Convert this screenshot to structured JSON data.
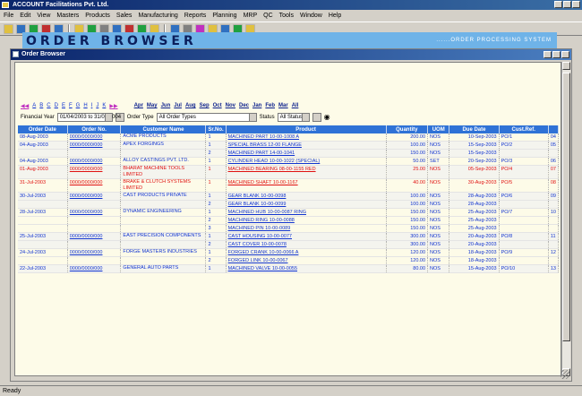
{
  "app": {
    "title": "ACCOUNT Facilitations Pvt. Ltd."
  },
  "menu": [
    "File",
    "Edit",
    "View",
    "Masters",
    "Products",
    "Sales",
    "Manufacturing",
    "Reports",
    "Planning",
    "MRP",
    "QC",
    "Tools",
    "Window",
    "Help"
  ],
  "window": {
    "title": "Order Browser"
  },
  "browser": {
    "title": "ORDER BROWSER",
    "tagline": "......ORDER PROCESSING SYSTEM"
  },
  "alphabet": [
    "A",
    "B",
    "C",
    "D",
    "E",
    "F",
    "G",
    "H",
    "I",
    "J",
    "K"
  ],
  "months": [
    "Apr",
    "May",
    "Jun",
    "Jul",
    "Aug",
    "Sep",
    "Oct",
    "Nov",
    "Dec",
    "Jan",
    "Feb",
    "Mar",
    "All"
  ],
  "filters": {
    "period_label": "Financial Year",
    "period_value": "01/04/2003 to 31/03/2004",
    "order_type_label": "Order Type",
    "order_type_value": "All Order Types",
    "status_label": "Status",
    "status_value": "All Status"
  },
  "table": {
    "columns": [
      "Order Date",
      "Order No.",
      "Customer Name",
      "Sr.No.",
      "Product",
      "Quantity",
      "UOM",
      "Due Date",
      "Cust.Ref.",
      ""
    ],
    "rows": [
      {
        "date": "08-Aug-2003",
        "order": "0000/0000/000",
        "customer": "ACME PRODUCTS",
        "items": [
          {
            "sr": "1",
            "product": "MACHINED PART 10-00-1008 A",
            "qty": "200.00",
            "uom": "NOS",
            "due": "10-Sep-2003",
            "ref": "PO/1",
            "x": "04"
          }
        ],
        "red": false
      },
      {
        "date": "04-Aug-2003",
        "order": "0000/0000/000",
        "customer": "APEX FORGINGS",
        "items": [
          {
            "sr": "1",
            "product": "SPECIAL BRASS 12-00 FLANGE",
            "qty": "100.00",
            "uom": "NOS",
            "due": "15-Sep-2003",
            "ref": "PO/2",
            "x": "05"
          },
          {
            "sr": "2",
            "product": "MACHINED PART 14-00-1041",
            "qty": "150.00",
            "uom": "NOS",
            "due": "15-Sep-2003",
            "ref": "",
            "x": ""
          }
        ],
        "red": false
      },
      {
        "date": "04-Aug-2003",
        "order": "0000/0000/000",
        "customer": "ALLOY CASTINGS PVT. LTD.",
        "items": [
          {
            "sr": "1",
            "product": "CYLINDER HEAD 10-00-1022 (SPECIAL)",
            "qty": "50.00",
            "uom": "SET",
            "due": "20-Sep-2003",
            "ref": "PO/3",
            "x": "06"
          }
        ],
        "red": false
      },
      {
        "date": "01-Aug-2003",
        "order": "0000/0000/000",
        "customer": "BHARAT MACHINE TOOLS LIMITED",
        "items": [
          {
            "sr": "1",
            "product": "MACHINED BEARING 08-00-1155 RED",
            "qty": "25.00",
            "uom": "NOS",
            "due": "05-Sep-2003",
            "ref": "PO/4",
            "x": "07"
          }
        ],
        "red": true
      },
      {
        "date": "31-Jul-2003",
        "order": "0000/0000/000",
        "customer": "BRAKE & CLUTCH SYSTEMS LIMITED",
        "items": [
          {
            "sr": "1",
            "product": "MACHINED SHAFT 10-00-1167",
            "qty": "40.00",
            "uom": "NOS",
            "due": "30-Aug-2003",
            "ref": "PO/5",
            "x": "08"
          }
        ],
        "red": true
      },
      {
        "date": "30-Jul-2003",
        "order": "0000/0000/000",
        "customer": "CAST PRODUCTS PRIVATE",
        "items": [
          {
            "sr": "1",
            "product": "GEAR BLANK 10-00-0098",
            "qty": "100.00",
            "uom": "NOS",
            "due": "28-Aug-2003",
            "ref": "PO/6",
            "x": "09"
          },
          {
            "sr": "2",
            "product": "GEAR BLANK 10-00-0099",
            "qty": "100.00",
            "uom": "NOS",
            "due": "28-Aug-2003",
            "ref": "",
            "x": ""
          }
        ],
        "red": false
      },
      {
        "date": "28-Jul-2003",
        "order": "0000/0000/000",
        "customer": "DYNAMIC ENGINEERING",
        "items": [
          {
            "sr": "1",
            "product": "MACHINED HUB 10-00-0087 RING",
            "qty": "150.00",
            "uom": "NOS",
            "due": "25-Aug-2003",
            "ref": "PO/7",
            "x": "10"
          },
          {
            "sr": "2",
            "product": "MACHINED RING 10-00-0088",
            "qty": "150.00",
            "uom": "NOS",
            "due": "25-Aug-2003",
            "ref": "",
            "x": ""
          },
          {
            "sr": "3",
            "product": "MACHINED PIN 10-00-0089",
            "qty": "150.00",
            "uom": "NOS",
            "due": "25-Aug-2003",
            "ref": "",
            "x": ""
          }
        ],
        "red": false
      },
      {
        "date": "25-Jul-2003",
        "order": "0000/0000/000",
        "customer": "EAST PRECISION COMPONENTS",
        "items": [
          {
            "sr": "1",
            "product": "CAST HOUSING 10-00-0077",
            "qty": "300.00",
            "uom": "NOS",
            "due": "20-Aug-2003",
            "ref": "PO/8",
            "x": "11"
          },
          {
            "sr": "2",
            "product": "CAST COVER 10-00-0078",
            "qty": "300.00",
            "uom": "NOS",
            "due": "20-Aug-2003",
            "ref": "",
            "x": ""
          }
        ],
        "red": false
      },
      {
        "date": "24-Jul-2003",
        "order": "0000/0000/000",
        "customer": "FORGE MASTERS INDUSTRIES",
        "items": [
          {
            "sr": "1",
            "product": "FORGED CRANK 10-00-0066 A",
            "qty": "120.00",
            "uom": "NOS",
            "due": "18-Aug-2003",
            "ref": "PO/9",
            "x": "12"
          },
          {
            "sr": "2",
            "product": "FORGED LINK 10-00-0067",
            "qty": "120.00",
            "uom": "NOS",
            "due": "18-Aug-2003",
            "ref": "",
            "x": ""
          }
        ],
        "red": false
      },
      {
        "date": "22-Jul-2003",
        "order": "0000/0000/000",
        "customer": "GENERAL AUTO PARTS",
        "items": [
          {
            "sr": "1",
            "product": "MACHINED VALVE 10-00-0055",
            "qty": "80.00",
            "uom": "NOS",
            "due": "15-Aug-2003",
            "ref": "PO/10",
            "x": "13"
          }
        ],
        "red": false
      }
    ]
  },
  "status": {
    "text": "Ready"
  }
}
